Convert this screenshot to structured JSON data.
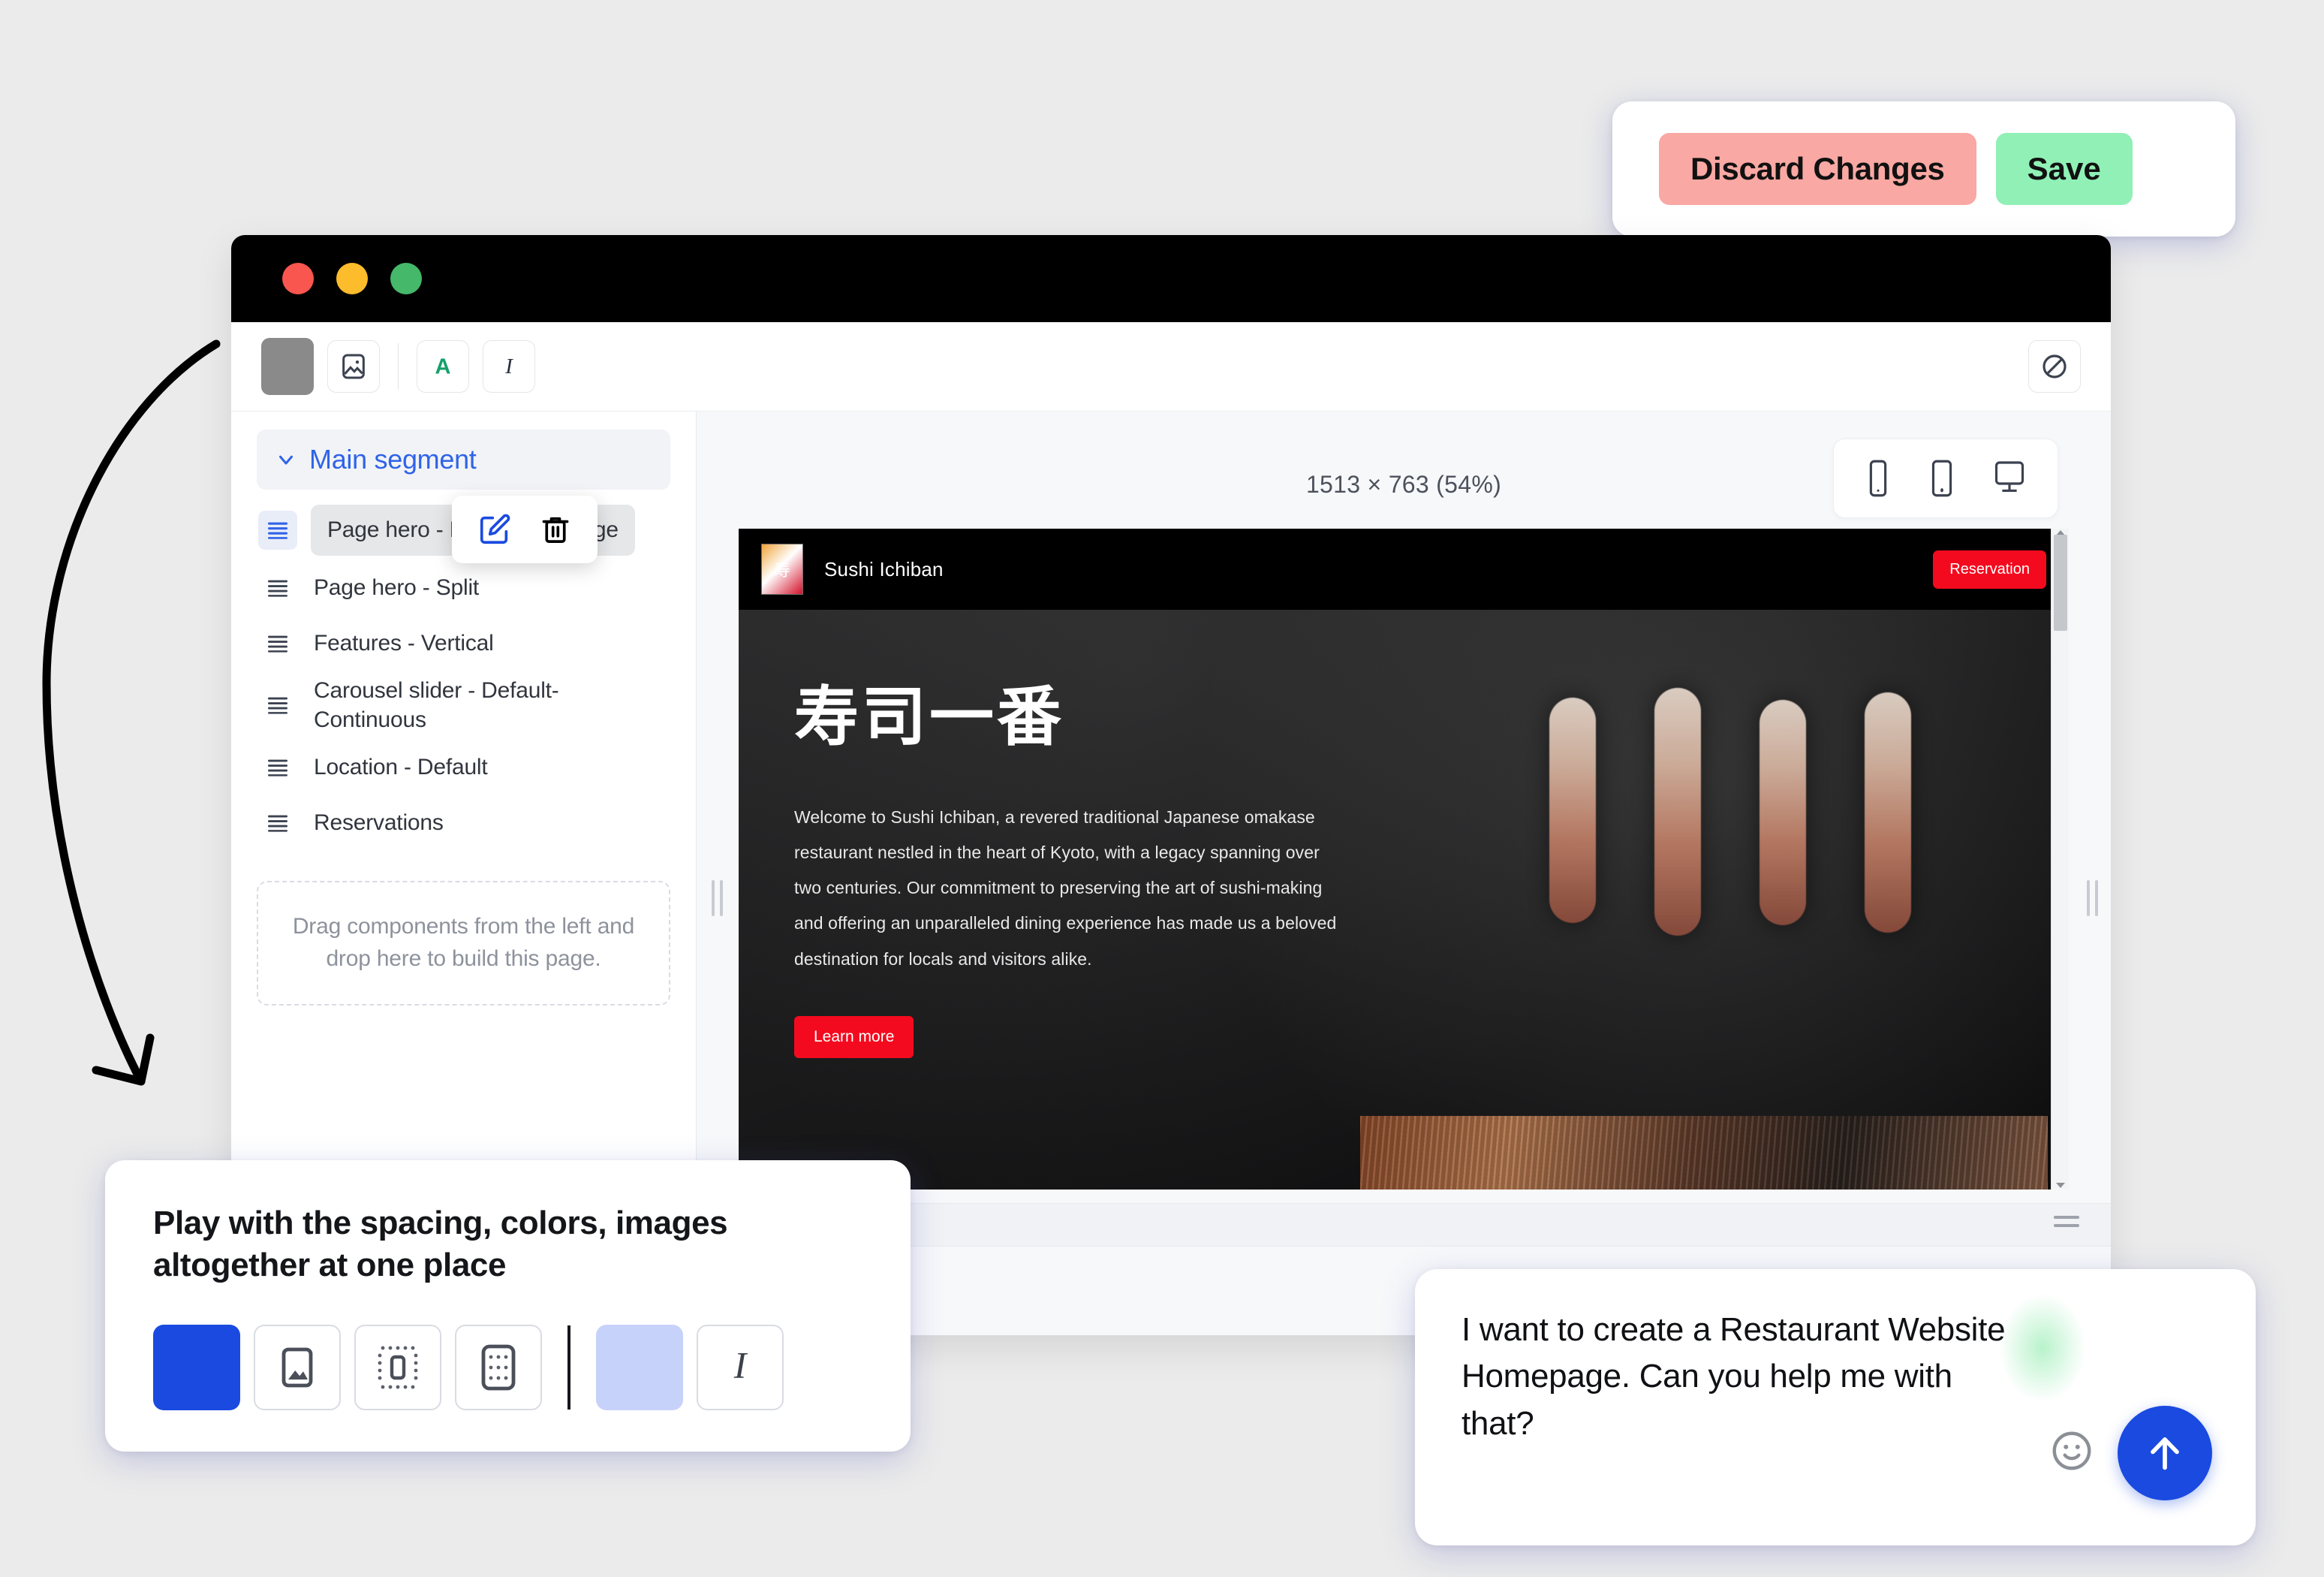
{
  "save_card": {
    "discard_label": "Discard Changes",
    "save_label": "Save",
    "discard_color": "#f9a8a3",
    "save_color": "#90f0b6"
  },
  "browser": {
    "traffic_lights": [
      "close-red",
      "minimize-yellow",
      "maximize-green"
    ]
  },
  "toolbar": {
    "items": [
      {
        "name": "background-color-swatch",
        "icon": "color-swatch-icon",
        "color": "#8a8a8a"
      },
      {
        "name": "background-image",
        "icon": "image-icon"
      },
      {
        "name": "text-color",
        "icon": "letter-a-icon",
        "color": "#14a06a"
      },
      {
        "name": "italic",
        "icon": "italic-icon"
      }
    ],
    "clear_formatting": {
      "name": "no-style",
      "icon": "prohibited-icon"
    }
  },
  "left_panel": {
    "segment": {
      "label": "Main segment",
      "expanded": true,
      "accent": "#2f63e8"
    },
    "components": [
      {
        "label": "Page hero - Full-Width-Image",
        "active": true
      },
      {
        "label": "Page hero - Split",
        "active": false
      },
      {
        "label": "Features - Vertical",
        "active": false
      },
      {
        "label": "Carousel slider - Default-Continuous",
        "active": false
      },
      {
        "label": "Location - Default",
        "active": false
      },
      {
        "label": "Reservations",
        "active": false
      }
    ],
    "row_actions": {
      "edit": {
        "name": "edit-component",
        "icon": "pencil-square-icon",
        "color": "#1a4ae0"
      },
      "delete": {
        "name": "delete-component",
        "icon": "trash-icon",
        "color": "#000000"
      }
    },
    "dropzone_text": "Drag components from the left and drop here to build this page."
  },
  "canvas": {
    "zoom_label": "1513 × 763 (54%)",
    "devices": [
      {
        "name": "mobile",
        "icon": "phone-icon",
        "active": false
      },
      {
        "name": "tablet",
        "icon": "tablet-icon",
        "active": false
      },
      {
        "name": "desktop",
        "icon": "monitor-icon",
        "active": true
      }
    ],
    "resize_handles": [
      "left-resize-handle",
      "right-resize-handle",
      "bottom-resize-handle"
    ]
  },
  "preview_site": {
    "brand": "Sushi Ichiban",
    "nav_cta": "Reservation",
    "hero_title": "寿司一番",
    "hero_body": "Welcome to Sushi Ichiban, a revered traditional Japanese omakase restaurant nestled in the heart of Kyoto, with a legacy spanning over two centuries. Our commitment to preserving the art of sushi-making and offering an unparalleled dining experience has made us a beloved destination for locals and visitors alike.",
    "hero_cta": "Learn more",
    "accent_red": "#f40a1e"
  },
  "hint_card": {
    "title": "Play with the spacing, colors, images altogether at one place",
    "tiles": [
      {
        "name": "primary-color-swatch",
        "icon": "color-swatch-icon",
        "color": "#1a4ae0"
      },
      {
        "name": "image-tile",
        "icon": "image-icon"
      },
      {
        "name": "margin-tile",
        "icon": "margin-spacing-icon"
      },
      {
        "name": "padding-tile",
        "icon": "padding-spacing-icon"
      },
      {
        "name": "secondary-color-swatch",
        "icon": "color-swatch-icon",
        "color": "#c7d2fb"
      },
      {
        "name": "italic-tile",
        "icon": "italic-icon"
      }
    ]
  },
  "chat_card": {
    "message": "I want to create a Restaurant Website Homepage. Can you help me with that?",
    "emoji_button": "smiley-icon",
    "send_button": "arrow-up-icon",
    "send_color": "#1a4ae0"
  }
}
